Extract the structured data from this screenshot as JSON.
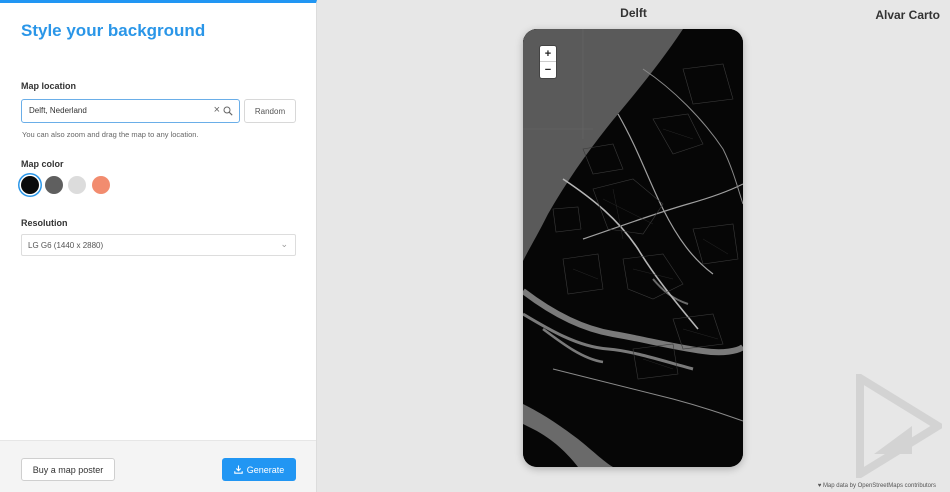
{
  "panel": {
    "title": "Style your background",
    "map_location": {
      "label": "Map location",
      "value": "Delft, Nederland",
      "random_label": "Random",
      "hint": "You can also zoom and drag the map to any location."
    },
    "map_color": {
      "label": "Map color",
      "swatches": [
        "#0b0b0b",
        "#5f5f5f",
        "#dcdcdc",
        "#f28c6f"
      ],
      "selected_index": 0
    },
    "resolution": {
      "label": "Resolution",
      "value": "LG G6 (1440 x 2880)"
    },
    "footer": {
      "buy_label": "Buy a map poster",
      "generate_label": "Generate"
    }
  },
  "preview": {
    "city": "Delft",
    "brand": "Alvar Carto",
    "zoom_in": "+",
    "zoom_out": "−",
    "attribution": "Map data by OpenStreetMaps contributors",
    "colors": {
      "land": "#060606",
      "sea": "#5a5a5a",
      "water": "#7a7a7a",
      "roads": "#9a9a9a"
    }
  },
  "accent": "#2196f3"
}
